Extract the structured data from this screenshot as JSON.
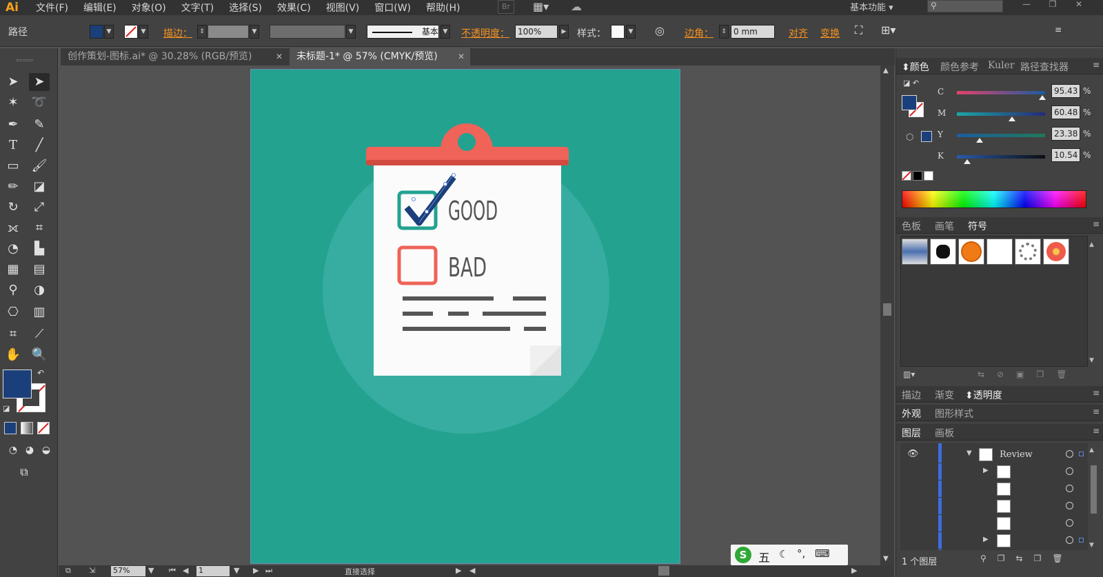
{
  "app": {
    "logo": "Ai"
  },
  "menu": [
    "文件(F)",
    "编辑(E)",
    "对象(O)",
    "文字(T)",
    "选择(S)",
    "效果(C)",
    "视图(V)",
    "窗口(W)",
    "帮助(H)"
  ],
  "menubar": {
    "br": "Br",
    "workspace": "基本功能"
  },
  "control": {
    "path_label": "路径",
    "stroke_label": "描边：",
    "stroke_style": "基本",
    "opacity_label": "不透明度：",
    "opacity_value": "100%",
    "style_label": "样式：",
    "corner_label": "边角：",
    "corner_value": "0 mm",
    "align_label": "对齐",
    "transform_label": "变换",
    "fill_color": "#1b3f7a"
  },
  "tabs": [
    {
      "label": "创作策划-图标.ai* @ 30.28% (RGB/预览)",
      "active": false
    },
    {
      "label": "未标题-1* @ 57% (CMYK/预览)",
      "active": true
    }
  ],
  "artwork": {
    "good_label": "GOOD",
    "bad_label": "BAD",
    "background_color": "#23a290",
    "clip_color": "#ef6358",
    "check_color": "#1b3f7a"
  },
  "statusbar": {
    "zoom": "57%",
    "page": "1",
    "tool_name": "直接选择"
  },
  "color_panel": {
    "tabs": [
      "颜色",
      "颜色参考",
      "Kuler",
      "路径查找器"
    ],
    "channels": [
      {
        "label": "C",
        "value": "95.43",
        "position": 0.94
      },
      {
        "label": "M",
        "value": "60.48",
        "position": 0.6
      },
      {
        "label": "Y",
        "value": "23.38",
        "position": 0.23
      },
      {
        "label": "K",
        "value": "10.54",
        "position": 0.1
      }
    ],
    "pct": "%"
  },
  "swatch_panel": {
    "tabs": [
      "色板",
      "画笔",
      "符号"
    ]
  },
  "transparency_panel": {
    "tabs": [
      "描边",
      "渐变",
      "透明度"
    ]
  },
  "appearance_panel": {
    "tabs": [
      "外观",
      "图形样式"
    ]
  },
  "layers_panel": {
    "tabs": [
      "图层",
      "画板"
    ],
    "top_layer": "Review",
    "footer": "1 个图层"
  },
  "ime": {
    "label": "五"
  }
}
